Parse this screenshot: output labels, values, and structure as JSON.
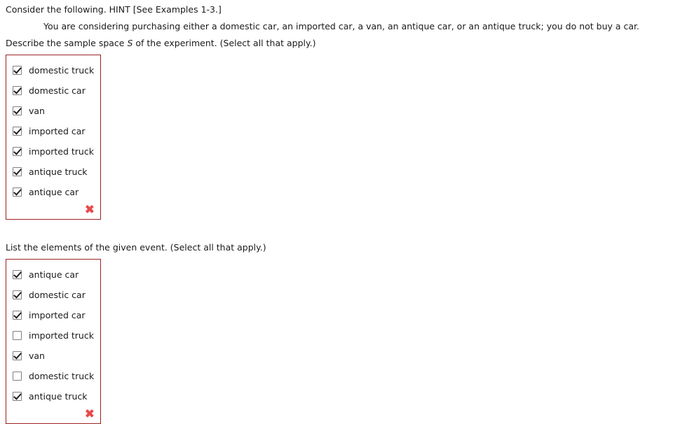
{
  "intro": {
    "prompt": "Consider the following. HINT [See Examples 1-3.]",
    "scenario": "You are considering purchasing either a domestic car, an imported car, a van, an antique car, or an antique truck; you do not buy a car."
  },
  "colors": {
    "box_border": "#9c2222",
    "wrong_mark": "#e8494b",
    "text": "#1a1a1a",
    "checkbox_border": "#808080",
    "check_glyph": "#222222"
  },
  "questions": [
    {
      "text_before_var": "Describe the sample space ",
      "variable": "S",
      "text_after_var": " of the experiment. (Select all that apply.)",
      "mark": "✖",
      "mark_meaning": "incorrect",
      "options": [
        {
          "label": "domestic truck",
          "checked": true
        },
        {
          "label": "domestic car",
          "checked": true
        },
        {
          "label": "van",
          "checked": true
        },
        {
          "label": "imported car",
          "checked": true
        },
        {
          "label": "imported truck",
          "checked": true
        },
        {
          "label": "antique truck",
          "checked": true
        },
        {
          "label": "antique car",
          "checked": true
        }
      ]
    },
    {
      "text_before_var": "List the elements of the given event. (Select all that apply.)",
      "variable": "",
      "text_after_var": "",
      "mark": "✖",
      "mark_meaning": "incorrect",
      "options": [
        {
          "label": "antique car",
          "checked": true
        },
        {
          "label": "domestic car",
          "checked": true
        },
        {
          "label": "imported car",
          "checked": true
        },
        {
          "label": "imported truck",
          "checked": false
        },
        {
          "label": "van",
          "checked": true
        },
        {
          "label": "domestic truck",
          "checked": false
        },
        {
          "label": "antique truck",
          "checked": true
        }
      ]
    }
  ]
}
